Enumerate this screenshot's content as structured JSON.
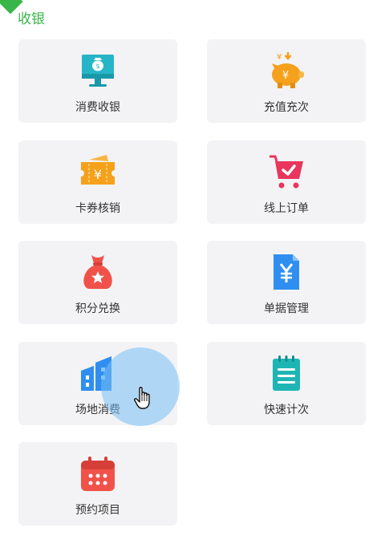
{
  "section": {
    "title": "收银"
  },
  "tiles": [
    {
      "label": "消费收银",
      "icon": "cash-register-monitor-icon"
    },
    {
      "label": "充值充次",
      "icon": "piggy-bank-icon"
    },
    {
      "label": "卡券核销",
      "icon": "coupon-ticket-icon"
    },
    {
      "label": "线上订单",
      "icon": "shopping-cart-icon"
    },
    {
      "label": "积分兑换",
      "icon": "money-bag-icon"
    },
    {
      "label": "单据管理",
      "icon": "receipt-document-icon"
    },
    {
      "label": "场地消费",
      "icon": "building-icon"
    },
    {
      "label": "快速计次",
      "icon": "notepad-icon"
    },
    {
      "label": "预约项目",
      "icon": "calendar-icon"
    }
  ],
  "colors": {
    "accent": "#39b54a",
    "tile_bg": "#f3f3f5",
    "label": "#333333"
  }
}
